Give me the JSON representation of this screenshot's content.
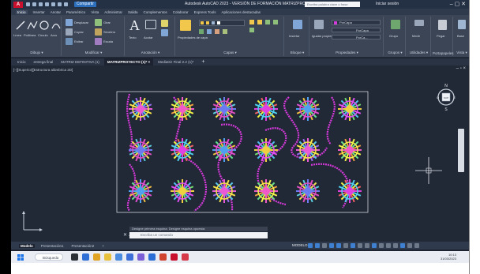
{
  "app": {
    "logo_text": "A",
    "share_label": "Compartir",
    "window_title": "Autodesk AutoCAD 2023 - VERSIÓN DE FORMACIÓN   MATRIZPROYECTO (1).dwg",
    "search_placeholder": "Escriba palabra clave o frase",
    "signin_label": "Iniciar sesión",
    "window_controls": "–  ▢  ✕"
  },
  "ribbon_tabs": [
    "Inicio",
    "Insertar",
    "Anotar",
    "Paramétrico",
    "Vista",
    "Administrar",
    "Salida",
    "Complementos",
    "Colaborar",
    "Express Tools",
    "Aplicaciones destacadas"
  ],
  "ribbon": {
    "draw": {
      "label": "Dibujo ▾",
      "tools": [
        "Línea",
        "Polilínea",
        "Círculo",
        "Arco"
      ]
    },
    "modify": {
      "label": "Modificar ▾",
      "tools": [
        "Desplazar",
        "Girar",
        "Copiar",
        "Simetría",
        "Estirar",
        "Escala"
      ]
    },
    "annotation": {
      "label": "Anotación ▾",
      "tools": [
        "Texto",
        "Acotar"
      ]
    },
    "layers": {
      "label": "Capas ▾",
      "tools": [
        "Propiedades de capa"
      ]
    },
    "block": {
      "label": "Bloque ▾",
      "tools": [
        "Insertar"
      ]
    },
    "properties": {
      "label": "Propiedades ▾",
      "tools": [
        "Igualar propiedades"
      ],
      "layer_color": "PorCapa",
      "bylayer_lines": [
        "PorCapa",
        "PorCa..."
      ]
    },
    "groups": {
      "label": "Grupos ▾",
      "tools": [
        "Grupo"
      ]
    },
    "utilities": {
      "label": "Utilidades ▾",
      "tools": [
        "Medir"
      ]
    },
    "clipboard": {
      "label": "Portapapeles",
      "tools": [
        "Pegar"
      ]
    },
    "view": {
      "label": "Vista ▾",
      "tools": [
        "Base"
      ]
    }
  },
  "file_tabs": [
    {
      "label": "Inicio",
      "active": false
    },
    {
      "label": "entrega final",
      "active": false
    },
    {
      "label": "MATRIZ DEFINITIVA (1)",
      "active": false
    },
    {
      "label": "MATRIZPROYECTO (1)* ×",
      "active": true
    },
    {
      "label": "Mediatriz Final 2.2 (1)*",
      "active": false
    }
  ],
  "viewport": {
    "label": "[–][Superior][Estructura alámbrica 2D]",
    "controls": "– ▫ ×",
    "compass": {
      "n": "N",
      "s": "S",
      "e": "E",
      "o": "O",
      "center": "SUP"
    }
  },
  "command": {
    "history": "Designe primera esquina: Designe esquina opuesta:",
    "placeholder": "Escriba un comando",
    "buttons": "✕ ⟋"
  },
  "layout_tabs": [
    {
      "label": "Modelo",
      "active": true
    },
    {
      "label": "Presentación1",
      "active": false
    },
    {
      "label": "Presentación2",
      "active": false
    },
    {
      "label": "+",
      "active": false
    }
  ],
  "status": {
    "model_label": "MODELO"
  },
  "taskbar": {
    "search_label": "Búsqueda",
    "time": "10:13",
    "date": "31/03/2023"
  },
  "colors": {
    "background": "#1d2331",
    "ribbon": "#3b4556",
    "accent": "#2c6fbd",
    "wave": "#d43ad9",
    "frame": "#cfd4dc"
  },
  "drawing_motifs": {
    "rows": 3,
    "columns": 6
  }
}
